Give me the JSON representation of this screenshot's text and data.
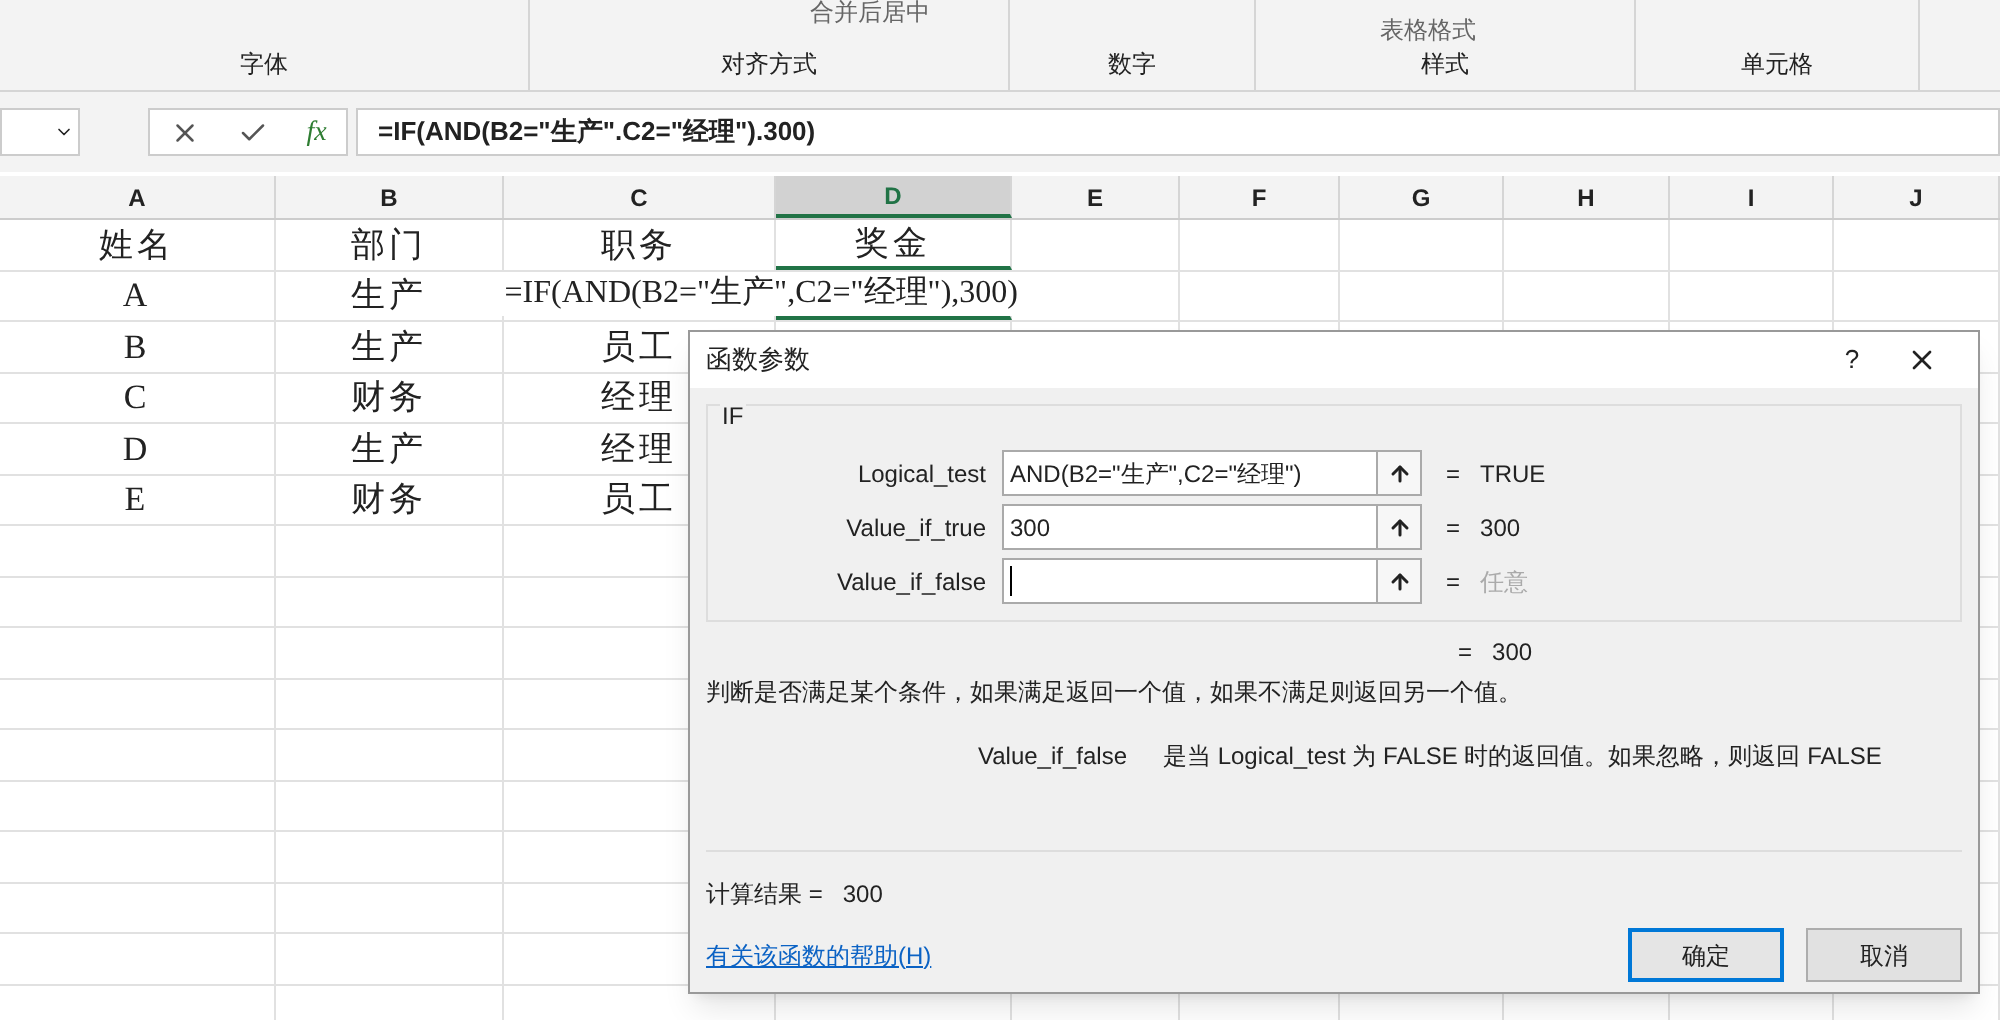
{
  "ribbon": {
    "groups": [
      {
        "label": "字体"
      },
      {
        "label": "对齐方式"
      },
      {
        "label": "数字"
      },
      {
        "label": "样式"
      },
      {
        "label": "单元格"
      }
    ],
    "merge_button": "合并后居中",
    "table_format_button": "表格格式"
  },
  "formula_bar": {
    "fx_label": "fx",
    "formula": "=IF(AND(B2=\"生产\".C2=\"经理\").300)"
  },
  "sheet": {
    "columns": [
      {
        "label": "A",
        "selected": false
      },
      {
        "label": "B",
        "selected": false
      },
      {
        "label": "C",
        "selected": false
      },
      {
        "label": "D",
        "selected": true
      },
      {
        "label": "E",
        "selected": false
      },
      {
        "label": "F",
        "selected": false
      },
      {
        "label": "G",
        "selected": false
      },
      {
        "label": "H",
        "selected": false
      },
      {
        "label": "I",
        "selected": false
      },
      {
        "label": "J",
        "selected": false
      }
    ],
    "rows": [
      [
        "姓名",
        "部门",
        "职务",
        "奖金"
      ],
      [
        "A",
        "生产",
        "",
        "=IF(AND(B2=\"生产\",C2=\"经理\"),300)"
      ],
      [
        "B",
        "生产",
        "员工"
      ],
      [
        "C",
        "财务",
        "经理"
      ],
      [
        "D",
        "生产",
        "经理"
      ],
      [
        "E",
        "财务",
        "员工"
      ]
    ]
  },
  "dialog": {
    "title": "函数参数",
    "help": "?",
    "function_name": "IF",
    "args": [
      {
        "label": "Logical_test",
        "value": "AND(B2=\"生产\",C2=\"经理\")",
        "equals": "=",
        "result": "TRUE",
        "dimmed": false
      },
      {
        "label": "Value_if_true",
        "value": "300",
        "equals": "=",
        "result": "300",
        "dimmed": false
      },
      {
        "label": "Value_if_false",
        "equals": "=",
        "result": "任意",
        "dimmed": true
      }
    ],
    "total_equals": "=",
    "total": "300",
    "description": "判断是否满足某个条件，如果满足返回一个值，如果不满足则返回另一个值。",
    "arg_help": {
      "name": "Value_if_false",
      "text": "是当 Logical_test 为 FALSE 时的返回值。如果忽略，则返回 FALSE"
    },
    "calc_label": "计算结果 =",
    "calc_value": "300",
    "help_link": "有关该函数的帮助(H)",
    "buttons": [
      {
        "label": "确定",
        "default": true
      },
      {
        "label": "取消",
        "default": false
      }
    ]
  }
}
